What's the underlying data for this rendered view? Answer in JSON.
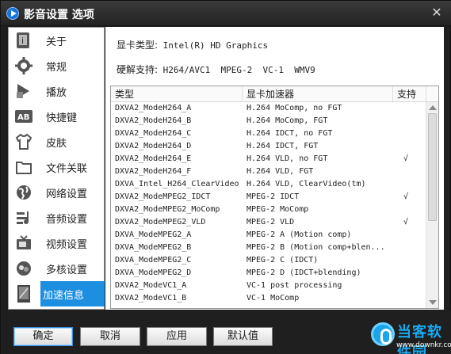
{
  "window": {
    "title": "影音设置 选项",
    "close_glyph": "✕"
  },
  "sidebar": {
    "items": [
      {
        "label": "关于",
        "icon": "about-icon"
      },
      {
        "label": "常规",
        "icon": "gear-icon"
      },
      {
        "label": "播放",
        "icon": "play-icon"
      },
      {
        "label": "快捷键",
        "icon": "ab-key-icon"
      },
      {
        "label": "皮肤",
        "icon": "shirt-icon"
      },
      {
        "label": "文件关联",
        "icon": "folder-icon"
      },
      {
        "label": "网络设置",
        "icon": "globe-icon"
      },
      {
        "label": "音频设置",
        "icon": "audio-icon"
      },
      {
        "label": "视频设置",
        "icon": "tv-icon"
      },
      {
        "label": "多核设置",
        "icon": "cpu-icon"
      },
      {
        "label": "加速信息",
        "icon": "accel-icon",
        "active": true
      }
    ]
  },
  "info": {
    "gpu_label": "显卡类型:",
    "gpu_value": "Intel(R) HD Graphics",
    "hw_label": "硬解支持:",
    "hw_value": "H264/AVC1  MPEG-2  VC-1  WMV9"
  },
  "table": {
    "headers": [
      "类型",
      "显卡加速器",
      "支持"
    ],
    "rows": [
      [
        "DXVA2_ModeH264_A",
        "H.264 MoComp, no FGT",
        ""
      ],
      [
        "DXVA2_ModeH264_B",
        "H.264 MoComp, FGT",
        ""
      ],
      [
        "DXVA2_ModeH264_C",
        "H.264 IDCT, no FGT",
        ""
      ],
      [
        "DXVA2_ModeH264_D",
        "H.264 IDCT, FGT",
        ""
      ],
      [
        "DXVA2_ModeH264_E",
        "H.264 VLD, no FGT",
        "√"
      ],
      [
        "DXVA2_ModeH264_F",
        "H.264 VLD, FGT",
        ""
      ],
      [
        "DXVA_Intel_H264_ClearVideo",
        "H.264 VLD, ClearVideo(tm)",
        ""
      ],
      [
        "DXVA2_ModeMPEG2_IDCT",
        "MPEG-2 IDCT",
        "√"
      ],
      [
        "DXVA2_ModeMPEG2_MoComp",
        "MPEG-2 MoComp",
        ""
      ],
      [
        "DXVA2_ModeMPEG2_VLD",
        "MPEG-2 VLD",
        "√"
      ],
      [
        "DXVA_ModeMPEG2_A",
        "MPEG-2 A (Motion comp)",
        ""
      ],
      [
        "DXVA_ModeMPEG2_B",
        "MPEG-2 B (Motion comp+blen...",
        ""
      ],
      [
        "DXVA_ModeMPEG2_C",
        "MPEG-2 C (IDCT)",
        ""
      ],
      [
        "DXVA_ModeMPEG2_D",
        "MPEG-2 D (IDCT+blending)",
        ""
      ],
      [
        "DXVA2_ModeVC1_A",
        "VC-1 post processing",
        ""
      ],
      [
        "DXVA2_ModeVC1_B",
        "VC-1 MoComp",
        ""
      ]
    ]
  },
  "buttons": {
    "ok": "确定",
    "cancel": "取消",
    "apply": "应用",
    "default": "默认值"
  },
  "watermark": {
    "title": "当客软件园",
    "url": "www.downkr.com"
  },
  "colors": {
    "accent": "#1e8fe0",
    "titlebar": "#2a2a2a"
  }
}
